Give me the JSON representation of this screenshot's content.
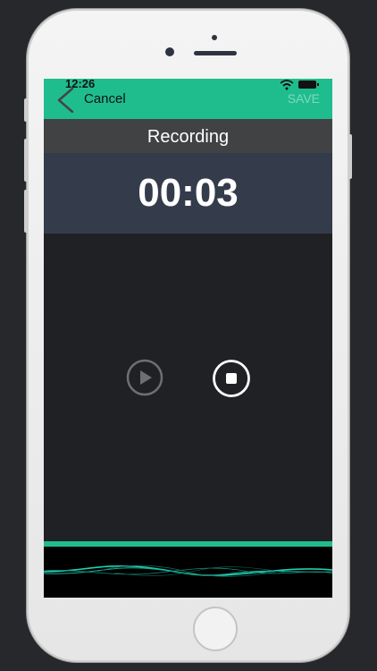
{
  "status": {
    "time": "12:26"
  },
  "navbar": {
    "cancel_label": "Cancel",
    "save_label": "SAVE"
  },
  "recorder": {
    "title": "Recording",
    "timer": "00:03"
  },
  "icons": {
    "back": "chevron-left-icon",
    "play": "play-icon",
    "stop": "stop-icon",
    "wifi": "wifi-icon",
    "battery": "battery-icon"
  },
  "colors": {
    "accent": "#1fbd8e",
    "title_bar": "#414243",
    "timer_bar": "#343c4b",
    "background": "#202125",
    "wave": "#1fd0b0"
  }
}
